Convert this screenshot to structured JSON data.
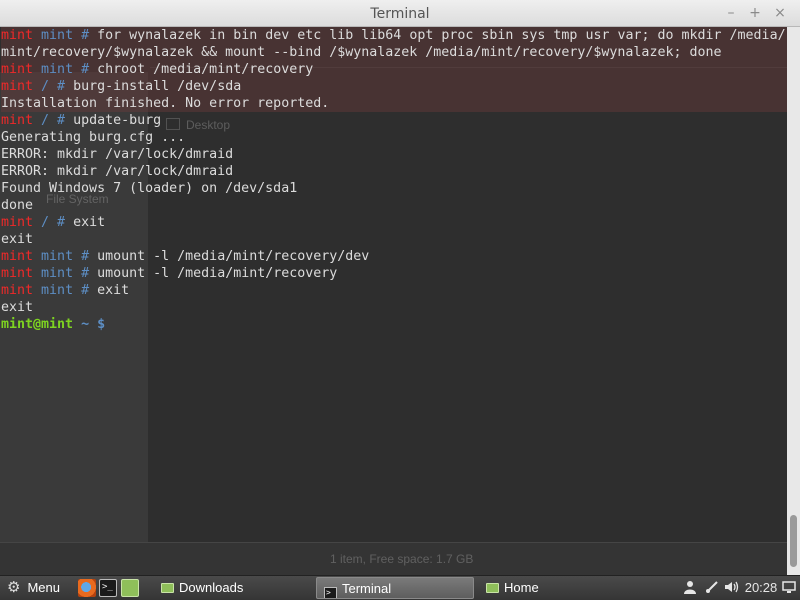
{
  "window": {
    "title": "Terminal",
    "controls": {
      "minimize": "–",
      "maximize": "+",
      "close": "×"
    }
  },
  "background_window": {
    "sidebar_item": "Desktop",
    "sidebar_item2": "File System",
    "status": "1 item, Free space: 1.7 GB"
  },
  "terminal": {
    "lines": [
      {
        "type": "rootmint",
        "cwd": "mint",
        "cmd": "for wynalazek in bin dev etc lib lib64 opt proc sbin sys tmp usr var; do mkdir /media/",
        "highlight": true
      },
      {
        "type": "out",
        "text": "mint/recovery/$wynalazek && mount --bind /$wynalazek /media/mint/recovery/$wynalazek; done",
        "highlight": true
      },
      {
        "type": "rootmint",
        "cwd": "mint",
        "cmd": "chroot /media/mint/recovery",
        "highlight": true
      },
      {
        "type": "rootmint",
        "cwd": "/",
        "cmd": "burg-install /dev/sda",
        "highlight": true
      },
      {
        "type": "out",
        "text": "Installation finished. No error reported.",
        "highlight": true
      },
      {
        "type": "rootmint",
        "cwd": "/",
        "cmd": "update-burg",
        "highlight": false
      },
      {
        "type": "out",
        "text": "Generating burg.cfg ...",
        "highlight": false
      },
      {
        "type": "out",
        "text": "ERROR: mkdir /var/lock/dmraid",
        "highlight": false
      },
      {
        "type": "out",
        "text": "ERROR: mkdir /var/lock/dmraid",
        "highlight": false
      },
      {
        "type": "out",
        "text": "Found Windows 7 (loader) on /dev/sda1",
        "highlight": false
      },
      {
        "type": "out",
        "text": "done",
        "highlight": false
      },
      {
        "type": "rootmint",
        "cwd": "/",
        "cmd": "exit",
        "highlight": false
      },
      {
        "type": "out",
        "text": "exit",
        "highlight": false
      },
      {
        "type": "rootmint",
        "cwd": "mint",
        "cmd": "umount -l /media/mint/recovery/dev",
        "highlight": false
      },
      {
        "type": "rootmint",
        "cwd": "mint",
        "cmd": "umount -l /media/mint/recovery",
        "highlight": false
      },
      {
        "type": "rootmint",
        "cwd": "mint",
        "cmd": "exit",
        "highlight": false
      },
      {
        "type": "out",
        "text": "exit",
        "highlight": false
      },
      {
        "type": "user",
        "userhost": "mint@mint",
        "cwd": "~",
        "sigil": "$",
        "cmd": "",
        "highlight": false
      }
    ],
    "root_user": "mint",
    "root_sigil": "#",
    "colors": {
      "prompt_user": "#ef2929",
      "prompt_path": "#5d8ec4",
      "prompt_userhost": "#7ed321",
      "text": "#dcdcdc",
      "background": "#2c2c2c"
    }
  },
  "taskbar": {
    "menu_label": "Menu",
    "launchers": [
      "firefox-icon",
      "terminal-icon",
      "folder-icon"
    ],
    "tasks": [
      {
        "label": "Downloads",
        "icon": "folder-icon",
        "active": false
      },
      {
        "label": "Terminal",
        "icon": "terminal-icon",
        "active": true
      },
      {
        "label": "Home",
        "icon": "folder-icon",
        "active": false
      }
    ],
    "tray": {
      "user_icon": "user-icon",
      "network_icon": "network-icon",
      "volume_icon": "volume-icon",
      "clock": "20:28",
      "display_icon": "display-icon"
    }
  }
}
